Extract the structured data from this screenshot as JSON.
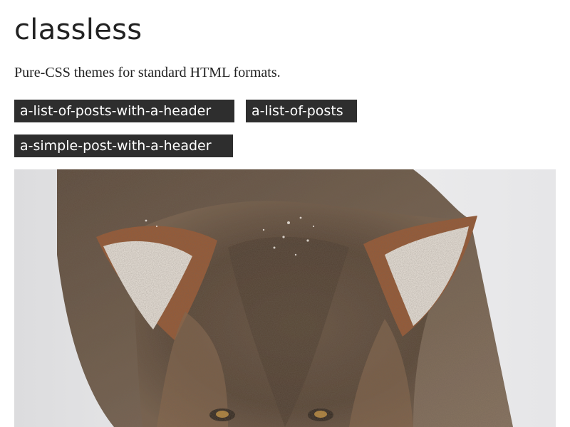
{
  "site": {
    "title": "classless",
    "tagline": "Pure-CSS themes for standard HTML formats."
  },
  "tags": [
    {
      "label": "a-list-of-posts-with-a-header"
    },
    {
      "label": "a-list-of-posts"
    },
    {
      "label": "a-simple-post-with-a-header"
    }
  ],
  "hero": {
    "icon": "coyote-photo",
    "colors": {
      "snow": "#e9e9ea",
      "fur_dark": "#4a3a2c",
      "fur_mid": "#7a5a40",
      "fur_rust": "#a0592b",
      "ear_inner": "#efe8e0"
    }
  }
}
